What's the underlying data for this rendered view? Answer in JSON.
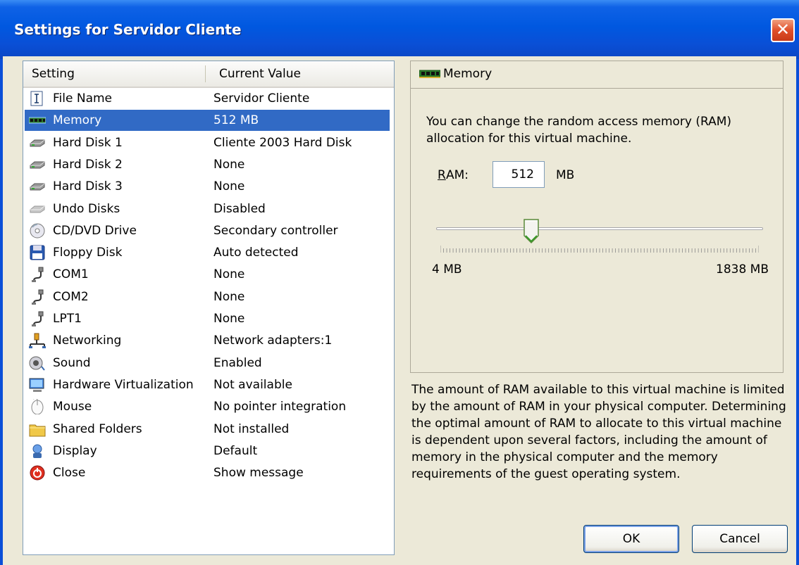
{
  "window": {
    "title": "Settings for Servidor Cliente",
    "close_glyph": "✕"
  },
  "list": {
    "header": {
      "setting": "Setting",
      "value": "Current Value"
    },
    "rows": [
      {
        "label": "File Name",
        "value": "Servidor Cliente",
        "icon": "text-cursor-icon"
      },
      {
        "label": "Memory",
        "value": "512 MB",
        "icon": "memory-chip-icon",
        "selected": true
      },
      {
        "label": "Hard Disk 1",
        "value": "Cliente 2003 Hard Disk",
        "icon": "hard-disk-icon"
      },
      {
        "label": "Hard Disk 2",
        "value": "None",
        "icon": "hard-disk-icon"
      },
      {
        "label": "Hard Disk 3",
        "value": "None",
        "icon": "hard-disk-icon"
      },
      {
        "label": "Undo Disks",
        "value": "Disabled",
        "icon": "undo-disk-icon"
      },
      {
        "label": "CD/DVD Drive",
        "value": "Secondary controller",
        "icon": "cd-dvd-icon"
      },
      {
        "label": "Floppy Disk",
        "value": "Auto detected",
        "icon": "floppy-icon"
      },
      {
        "label": "COM1",
        "value": "None",
        "icon": "serial-cable-icon"
      },
      {
        "label": "COM2",
        "value": "None",
        "icon": "serial-cable-icon"
      },
      {
        "label": "LPT1",
        "value": "None",
        "icon": "serial-cable-icon"
      },
      {
        "label": "Networking",
        "value": "Network adapters:1",
        "icon": "network-icon"
      },
      {
        "label": "Sound",
        "value": "Enabled",
        "icon": "speaker-icon"
      },
      {
        "label": "Hardware Virtualization",
        "value": "Not available",
        "icon": "monitor-chip-icon"
      },
      {
        "label": "Mouse",
        "value": "No pointer integration",
        "icon": "mouse-icon"
      },
      {
        "label": "Shared Folders",
        "value": "Not installed",
        "icon": "folder-icon"
      },
      {
        "label": "Display",
        "value": "Default",
        "icon": "display-icon"
      },
      {
        "label": "Close",
        "value": "Show message",
        "icon": "power-icon"
      }
    ]
  },
  "memory_panel": {
    "title": "Memory",
    "description": "You can change the random access memory (RAM) allocation for this virtual machine.",
    "ram_label_first": "R",
    "ram_label_rest": "AM:",
    "ram_value": "512",
    "ram_unit": "MB",
    "slider": {
      "min": 4,
      "max": 1838,
      "value": 512,
      "min_label": "4 MB",
      "max_label": "1838 MB"
    }
  },
  "help_text": "The amount of RAM available to this virtual machine is limited by the amount of RAM in your physical computer. Determining the optimal amount of RAM to allocate to this virtual machine is dependent upon several factors, including the amount of memory in the physical computer and the memory requirements of the guest operating system.",
  "buttons": {
    "ok": "OK",
    "cancel": "Cancel"
  },
  "colors": {
    "title_bar": "#0058e0",
    "selection": "#316ac5",
    "dialog_bg": "#ece9d8",
    "close_button": "#e0502a"
  }
}
